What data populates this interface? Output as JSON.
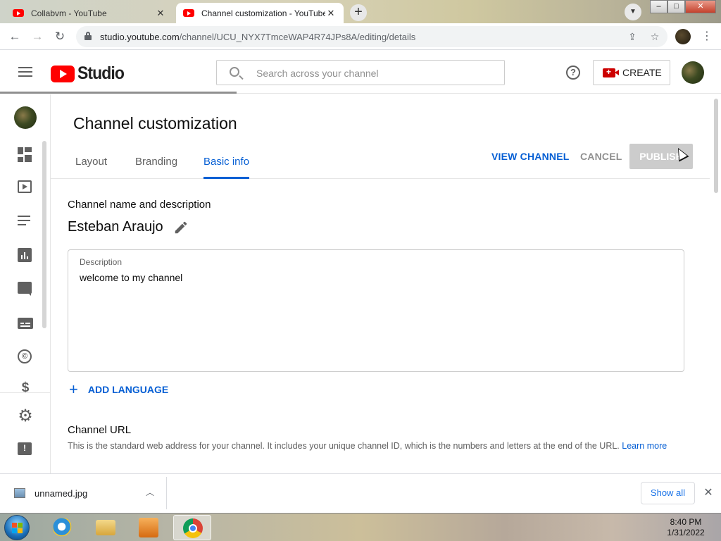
{
  "browser": {
    "tabs": [
      {
        "title": "Collabvm - YouTube",
        "active": false
      },
      {
        "title": "Channel customization - YouTube",
        "active": true
      }
    ],
    "url_host": "studio.youtube.com",
    "url_path": "/channel/UCU_NYX7TmceWAP4R74JPs8A/editing/details"
  },
  "header": {
    "logo_text": "Studio",
    "search_placeholder": "Search across your channel",
    "help_glyph": "?",
    "create_label": "CREATE"
  },
  "sidenav": {
    "items": [
      {
        "icon": "dashboard-icon"
      },
      {
        "icon": "content-icon"
      },
      {
        "icon": "playlists-icon"
      },
      {
        "icon": "analytics-icon"
      },
      {
        "icon": "comments-icon"
      },
      {
        "icon": "subtitles-icon"
      },
      {
        "icon": "copyright-icon"
      },
      {
        "icon": "monetization-icon"
      },
      {
        "icon": "settings-icon"
      },
      {
        "icon": "feedback-icon"
      }
    ],
    "copyright_glyph": "©",
    "dollar_glyph": "$",
    "gear_glyph": "⚙",
    "feedback_glyph": "!"
  },
  "main": {
    "page_title": "Channel customization",
    "tabs": [
      {
        "label": "Layout",
        "active": false
      },
      {
        "label": "Branding",
        "active": false
      },
      {
        "label": "Basic info",
        "active": true
      }
    ],
    "view_channel_label": "VIEW CHANNEL",
    "cancel_label": "CANCEL",
    "publish_label": "PUBLISH",
    "name_section_heading": "Channel name and description",
    "channel_name": "Esteban Araujo",
    "description_label": "Description",
    "description_value": "welcome to my channel",
    "add_language_label": "ADD LANGUAGE",
    "url_section_heading": "Channel URL",
    "url_section_desc": "This is the standard web address for your channel. It includes your unique channel ID, which is the numbers and letters at the end of the URL.",
    "learn_more": "Learn more"
  },
  "downloads": {
    "file_name": "unnamed.jpg",
    "show_all_label": "Show all"
  },
  "taskbar": {
    "time": "8:40 PM",
    "date": "1/31/2022"
  },
  "colors": {
    "accent_blue": "#065fd4",
    "youtube_red": "#ff0000",
    "disabled_gray": "#cccccc"
  }
}
